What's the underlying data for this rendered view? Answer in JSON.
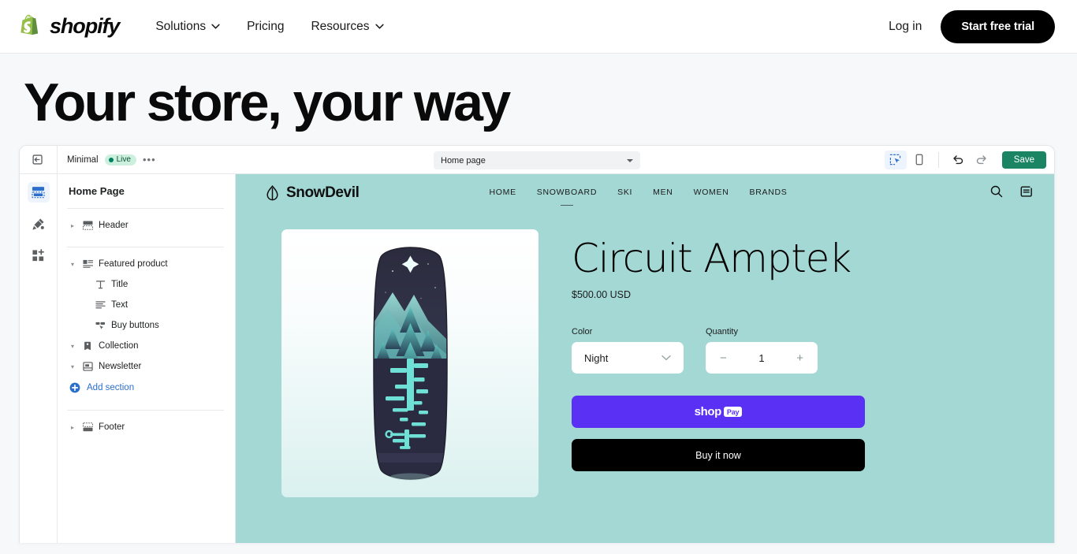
{
  "site_nav": {
    "brand": "shopify",
    "brand_icon": "shopify-bag-logo",
    "links": [
      {
        "label": "Solutions",
        "icon": "chevron-down-icon",
        "has_caret": true
      },
      {
        "label": "Pricing",
        "has_caret": false
      },
      {
        "label": "Resources",
        "icon": "chevron-down-icon",
        "has_caret": true
      }
    ],
    "login": "Log in",
    "cta": "Start free trial"
  },
  "hero": {
    "heading": "Your store, your way"
  },
  "editor": {
    "toolbar": {
      "exit_icon": "exit-editor-icon",
      "theme_name": "Minimal",
      "status_badge": "Live",
      "more_actions": "•••",
      "page_select": {
        "value": "Home page",
        "caret_icon": "caret-down-icon"
      },
      "icons": [
        {
          "name": "inspector-select-icon",
          "active": true
        },
        {
          "name": "mobile-preview-icon",
          "active": false
        },
        {
          "name": "undo-icon",
          "active": false
        },
        {
          "name": "redo-icon",
          "active": false
        }
      ],
      "save_label": "Save"
    },
    "rail": [
      {
        "name": "sections-icon",
        "active": true
      },
      {
        "name": "theme-settings-brush-icon",
        "active": false
      },
      {
        "name": "apps-grid-icon",
        "active": false
      }
    ],
    "sections_panel": {
      "title": "Home Page",
      "items": [
        {
          "label": "Header",
          "icon": "header-block-icon",
          "state": "collapsed",
          "depth": 0
        },
        {
          "label": "Featured product",
          "icon": "featured-product-icon",
          "state": "expanded",
          "depth": 0
        },
        {
          "label": "Title",
          "icon": "text-title-icon",
          "state": "none",
          "depth": 1
        },
        {
          "label": "Text",
          "icon": "text-lines-icon",
          "state": "none",
          "depth": 1
        },
        {
          "label": "Buy buttons",
          "icon": "buy-buttons-icon",
          "state": "none",
          "depth": 1
        },
        {
          "label": "Collection",
          "icon": "collection-tag-icon",
          "state": "expanded",
          "depth": 0
        },
        {
          "label": "Newsletter",
          "icon": "newsletter-icon",
          "state": "expanded",
          "depth": 0
        }
      ],
      "add_section": {
        "label": "Add section",
        "icon": "add-circle-icon"
      },
      "footer": {
        "label": "Footer",
        "icon": "footer-block-icon",
        "state": "collapsed"
      }
    },
    "preview": {
      "background_color": "#A3D8D5",
      "store": {
        "logo_icon": "snowdevil-drop-icon",
        "name": "SnowDevil",
        "nav": [
          {
            "label": "HOME",
            "current": false
          },
          {
            "label": "SNOWBOARD",
            "current": true
          },
          {
            "label": "SKI",
            "current": false
          },
          {
            "label": "MEN",
            "current": false
          },
          {
            "label": "WOMEN",
            "current": false
          },
          {
            "label": "BRANDS",
            "current": false
          }
        ],
        "icons": [
          {
            "name": "search-icon"
          },
          {
            "name": "cart-bag-icon",
            "badge": true
          }
        ]
      },
      "product": {
        "image_alt": "snowboard-night-forest-artwork",
        "title": "Circuit Amptek",
        "price": "$500.00 USD",
        "options": [
          {
            "label": "Color",
            "type": "select",
            "value": "Night",
            "caret_icon": "chevron-down-icon"
          },
          {
            "label": "Quantity",
            "type": "stepper",
            "value": "1",
            "minus": "−",
            "plus": "+"
          }
        ],
        "buttons": [
          {
            "name": "shop-pay-button",
            "word": "shop",
            "chip": "Pay",
            "color": "#5A31F4"
          },
          {
            "name": "buy-it-now-button",
            "label": "Buy it now",
            "color": "#000000"
          }
        ]
      }
    }
  }
}
